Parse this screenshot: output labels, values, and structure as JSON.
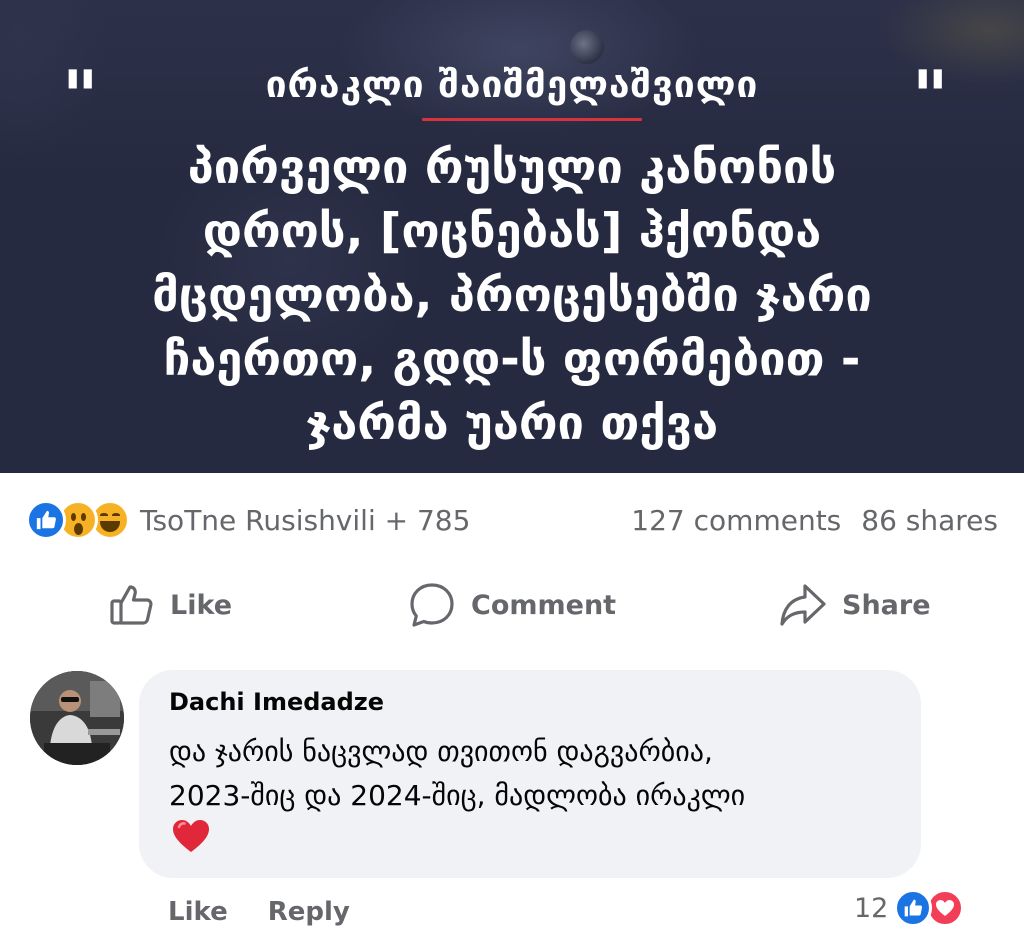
{
  "post_image": {
    "open_quote": "\"",
    "close_quote": "\"",
    "speaker": "ირაკლი შაიშმელაშვილი",
    "quote_lines": [
      "პირველი რუსული კანონის",
      "დროს, [ოცნებას] ჰქონდა",
      "მცდელობა, პროცესებში ჯარი",
      "ჩაერთო, გდდ-ს ფორმებით -",
      "ჯარმა უარი თქვა"
    ],
    "accent_color": "#d8323a",
    "background_color": "#262a40"
  },
  "summary": {
    "reaction_icons": [
      "like-icon",
      "wow-icon",
      "haha-icon"
    ],
    "names": "TsoTne Rusishvili + 785",
    "comments": "127 comments",
    "shares": "86 shares"
  },
  "actions": {
    "like": "Like",
    "comment": "Comment",
    "share": "Share"
  },
  "comment": {
    "author": "Dachi Imedadze",
    "text_lines": [
      "და ჯარის ნაცვლად თვითონ დაგვარბია,",
      "2023-შიც და 2024-შიც, მადლობა ირაკლი"
    ],
    "emoji": "red-heart-icon",
    "actions": {
      "like": "Like",
      "reply": "Reply"
    },
    "reaction_count": "12",
    "reaction_icons": [
      "like-icon",
      "love-icon"
    ]
  },
  "colors": {
    "facebook_blue": "#1b74e4",
    "secondary_text": "#65676b",
    "bubble": "#f0f2f5",
    "love": "#f33e58",
    "reaction_yellow": "#f7b125"
  }
}
